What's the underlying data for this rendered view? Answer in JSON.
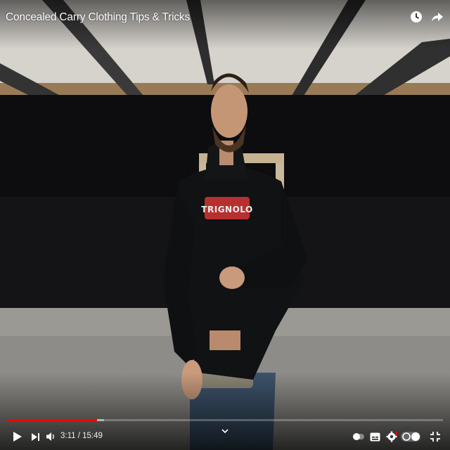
{
  "video": {
    "title": "Concealed Carry Clothing Tips & Tricks",
    "shirt_text": "TRIGNOLO",
    "time_current": "3:11",
    "time_separator": "/",
    "time_total": "15:49",
    "progress_played": 0.206,
    "progress_buffered": 0.222
  },
  "icons": {
    "watch_later": "clock-icon",
    "share": "share-arrow-icon",
    "play": "play-icon",
    "next": "next-icon",
    "volume": "volume-icon",
    "autoplay": "autoplay-toggle-icon",
    "subtitles": "subtitles-icon",
    "settings": "gear-icon",
    "fullscreen": "fullscreen-icon",
    "more": "chevron-down-icon"
  },
  "colors": {
    "progress_played": "#ff0000",
    "overlay_text": "#ffffff",
    "shirt_logo_red": "#b6302f"
  }
}
